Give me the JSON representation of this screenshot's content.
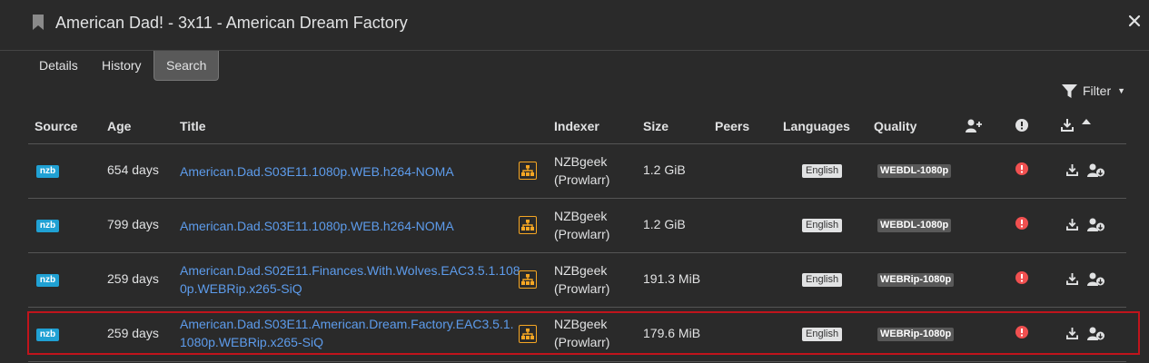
{
  "header": {
    "title": "American Dad! - 3x11 - American Dream Factory"
  },
  "tabs": [
    {
      "label": "Details"
    },
    {
      "label": "History"
    },
    {
      "label": "Search"
    }
  ],
  "filter": {
    "label": "Filter"
  },
  "columns": {
    "source": "Source",
    "age": "Age",
    "title": "Title",
    "indexer": "Indexer",
    "size": "Size",
    "peers": "Peers",
    "languages": "Languages",
    "quality": "Quality"
  },
  "rows": [
    {
      "source": "nzb",
      "age": "654 days",
      "title": "American.Dad.S03E11.1080p.WEB.h264-NOMA",
      "indexer_name": "NZBgeek",
      "indexer_sub": "(Prowlarr)",
      "size": "1.2 GiB",
      "language": "English",
      "quality": "WEBDL-1080p"
    },
    {
      "source": "nzb",
      "age": "799 days",
      "title": "American.Dad.S03E11.1080p.WEB.h264-NOMA",
      "indexer_name": "NZBgeek",
      "indexer_sub": "(Prowlarr)",
      "size": "1.2 GiB",
      "language": "English",
      "quality": "WEBDL-1080p"
    },
    {
      "source": "nzb",
      "age": "259 days",
      "title": "American.Dad.S02E11.Finances.With.Wolves.EAC3.5.1.1080p.WEBRip.x265-SiQ",
      "indexer_name": "NZBgeek",
      "indexer_sub": "(Prowlarr)",
      "size": "191.3 MiB",
      "language": "English",
      "quality": "WEBRip-1080p"
    },
    {
      "source": "nzb",
      "age": "259 days",
      "title": "American.Dad.S03E11.American.Dream.Factory.EAC3.5.1.1080p.WEBRip.x265-SiQ",
      "indexer_name": "NZBgeek",
      "indexer_sub": "(Prowlarr)",
      "size": "179.6 MiB",
      "language": "English",
      "quality": "WEBRip-1080p"
    }
  ],
  "colors": {
    "accent": "#5d9cec",
    "nzb": "#20a1d4",
    "warning": "#f05050",
    "tree": "#f5a623",
    "highlight": "#c0141c"
  }
}
